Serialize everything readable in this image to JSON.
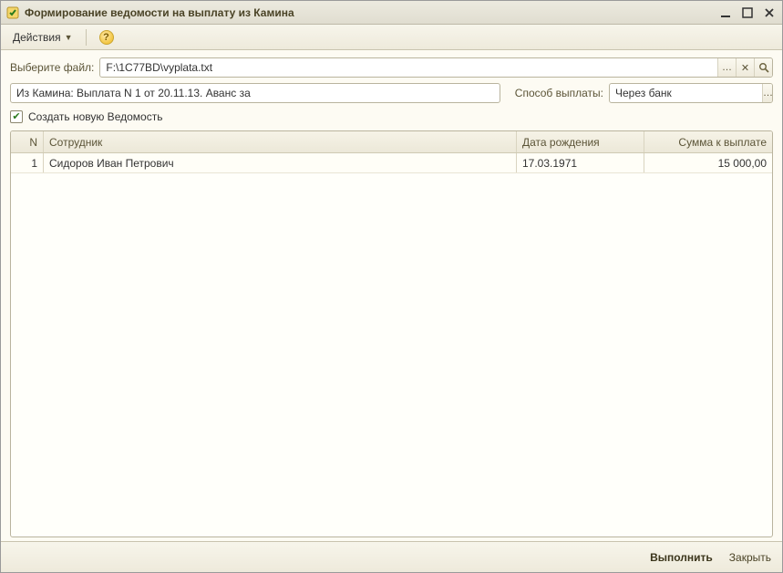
{
  "window": {
    "title": "Формирование ведомости на выплату из Камина"
  },
  "toolbar": {
    "actions_label": "Действия"
  },
  "fileRow": {
    "label": "Выберите файл:",
    "value": "F:\\1C77BD\\vyplata.txt"
  },
  "sourceRow": {
    "value": "Из Камина: Выплата N 1 от 20.11.13. Аванс за",
    "method_label": "Способ выплаты:",
    "method_value": "Через банк"
  },
  "checkbox": {
    "label": "Создать новую Ведомость",
    "checked": true
  },
  "table": {
    "headers": {
      "n": "N",
      "employee": "Сотрудник",
      "dob": "Дата рождения",
      "sum": "Сумма к выплате"
    },
    "rows": [
      {
        "n": "1",
        "employee": "Сидоров Иван Петрович",
        "dob": "17.03.1971",
        "sum": "15 000,00"
      }
    ]
  },
  "footer": {
    "execute": "Выполнить",
    "close": "Закрыть"
  }
}
